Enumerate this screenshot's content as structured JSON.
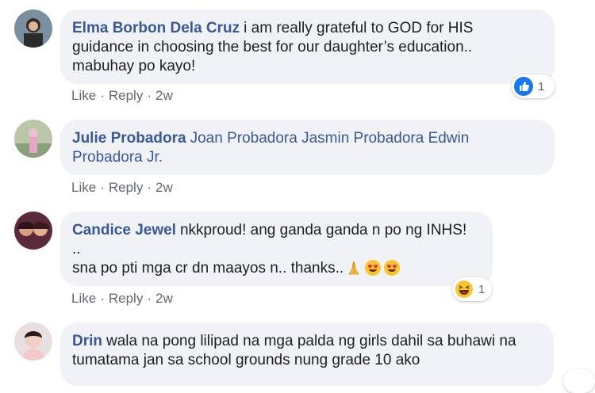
{
  "comments": [
    {
      "author": "Elma Borbon Dela Cruz",
      "lines": [
        "i am really grateful to GOD for HIS",
        "guidance in choosing the best for our daughter’s education..",
        "mabuhay po kayo!"
      ],
      "reaction": {
        "icon": "like-icon",
        "count": "1"
      },
      "actions": {
        "like": "Like",
        "reply": "Reply",
        "time": "2w",
        "sep": "·"
      }
    },
    {
      "author": "Julie Probadora",
      "lines": [
        "Joan Probadora Jasmin Probadora Edwin",
        "Probadora Jr."
      ],
      "actions": {
        "like": "Like",
        "reply": "Reply",
        "time": "2w",
        "sep": "·"
      }
    },
    {
      "author": "Candice Jewel",
      "lines": [
        "nkkproud! ang ganda ganda n po ng INHS!",
        "..",
        "sna po pti mga cr dn maayos n.. thanks.."
      ],
      "emojis": [
        "folded-hands-emoji",
        "heart-eyes-emoji",
        "heart-eyes-emoji"
      ],
      "reaction": {
        "icon": "haha-icon",
        "count": "1"
      },
      "actions": {
        "like": "Like",
        "reply": "Reply",
        "time": "2w",
        "sep": "·"
      }
    },
    {
      "author": "Drin",
      "lines": [
        "wala na pong lilipad na mga palda ng girls dahil sa buhawi na",
        "tumatama jan sa school grounds nung grade 10 ako"
      ]
    }
  ],
  "colors": {
    "author": "#385898",
    "bubble": "#f0f2f5",
    "meta": "#606770",
    "like_blue": "#1877f2"
  }
}
